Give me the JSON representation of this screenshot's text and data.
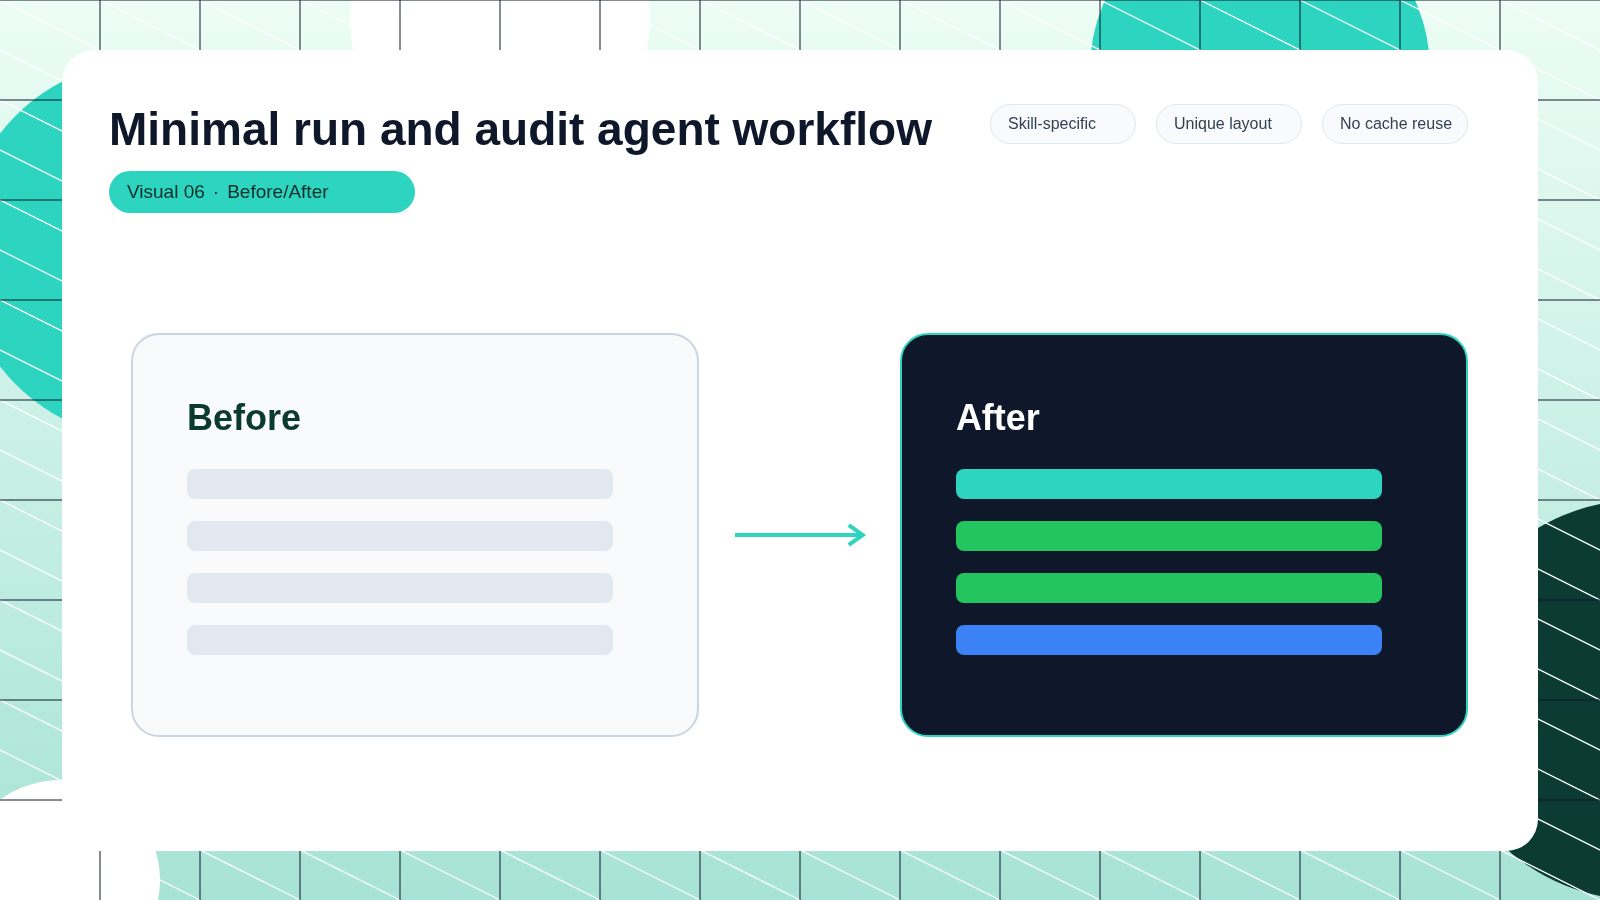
{
  "title": "Minimal run and audit agent workflow",
  "tag": {
    "label": "Visual 06",
    "separator": "·",
    "text": "Before/After"
  },
  "chips": [
    "Skill-specific",
    "Unique layout",
    "No cache reuse"
  ],
  "panels": [
    {
      "kind": "light",
      "heading": "Before",
      "bars": [
        {
          "color": "#e2e8f0"
        },
        {
          "color": "#e2e8f0"
        },
        {
          "color": "#e2e8f0"
        },
        {
          "color": "#e2e8f0"
        }
      ]
    },
    {
      "kind": "dark",
      "heading": "After",
      "bars": [
        {
          "color": "#2dd4bf"
        },
        {
          "color": "#22c55e"
        },
        {
          "color": "#22c55e"
        },
        {
          "color": "#3b82f6"
        }
      ]
    }
  ]
}
